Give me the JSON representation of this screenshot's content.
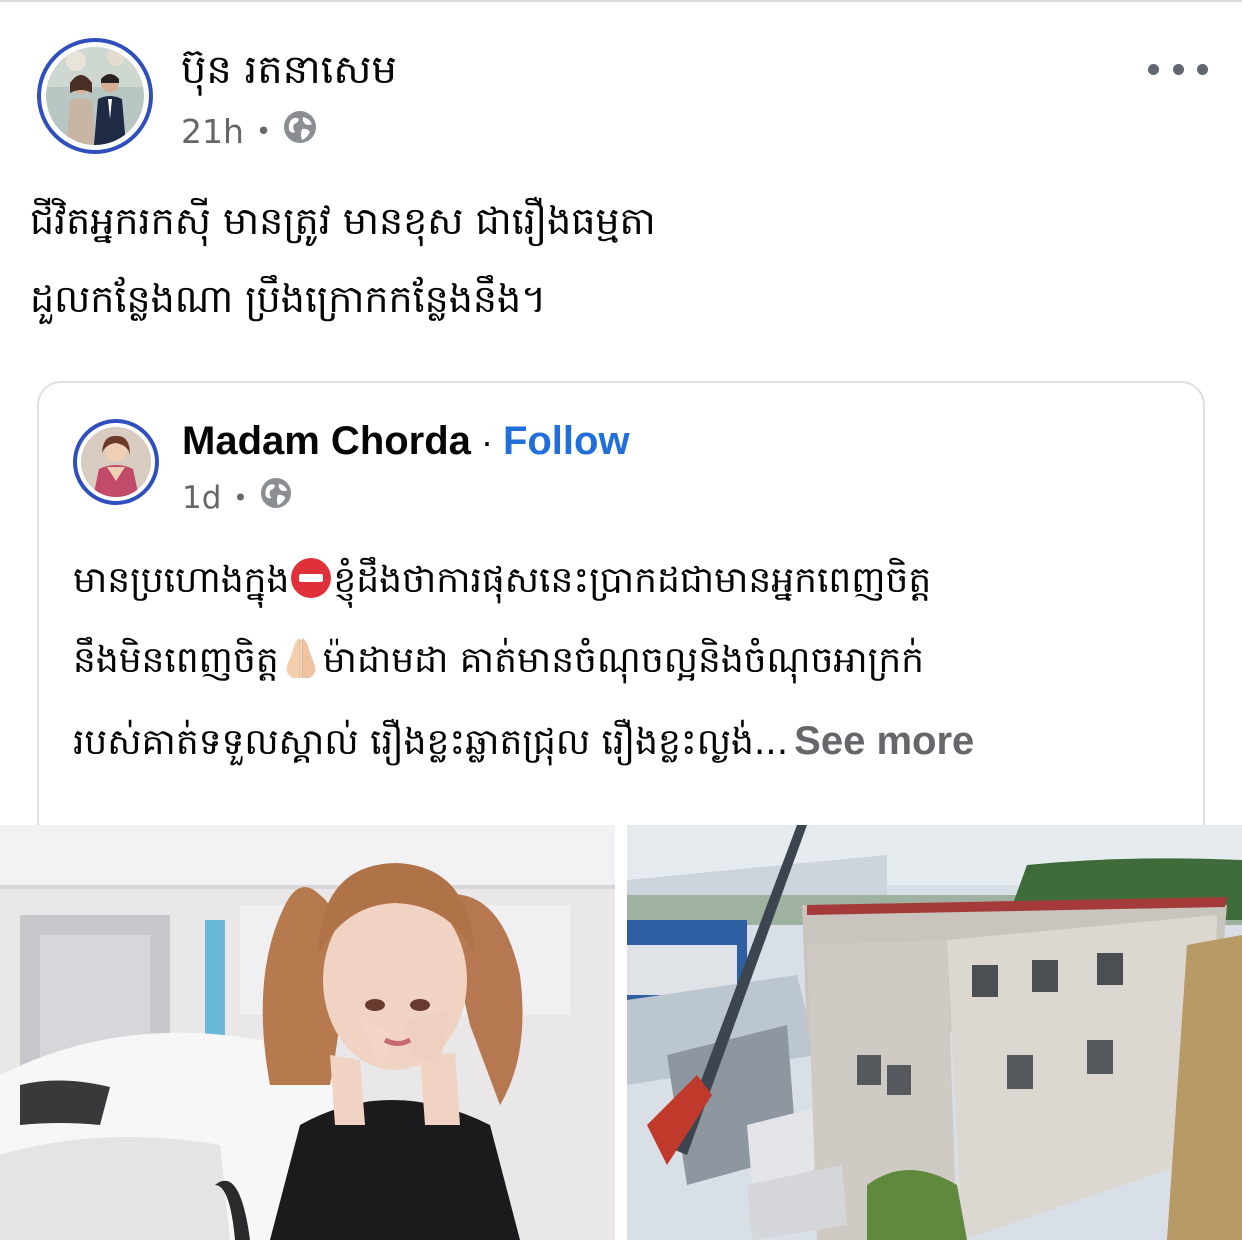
{
  "post": {
    "author_name": "ប៊ុន រតនាសេម",
    "time": "21h",
    "visibility_icon": "globe-icon",
    "more_icon": "more-horizontal-icon",
    "text_lines": [
      "ជីវិតអ្នករកស៊ី មានត្រូវ មានខុស ជារឿងធម្មតា",
      "ដួលកន្លែងណា ប្រឹងក្រោកកន្លែងនឹង។"
    ]
  },
  "shared": {
    "author_name": "Madam Chorda",
    "separator": "·",
    "follow_label": "Follow",
    "time": "1d",
    "visibility_icon": "globe-icon",
    "lines": {
      "l1a": "មានប្រហោងក្នុង",
      "l1b": "ខ្ញុំដឹងថាការផុសនេះប្រាកដជាមានអ្នកពេញចិត្ត",
      "l2a": "នឹងមិនពេញចិត្ត",
      "l2b": "ម៉ាដាមដា គាត់មានចំណុចល្អនិងចំណុចអាក្រក់",
      "l3": "របស់គាត់ទទួលស្គាល់ រឿងខ្លះឆ្លាតជ្រុល រឿងខ្លះល្ងង់..."
    },
    "see_more_label": "See more"
  },
  "colors": {
    "follow": "#216fdb",
    "muted": "#65676b",
    "avatar_ring": "#2f4fbf",
    "stop_emoji": "#e0313a"
  }
}
